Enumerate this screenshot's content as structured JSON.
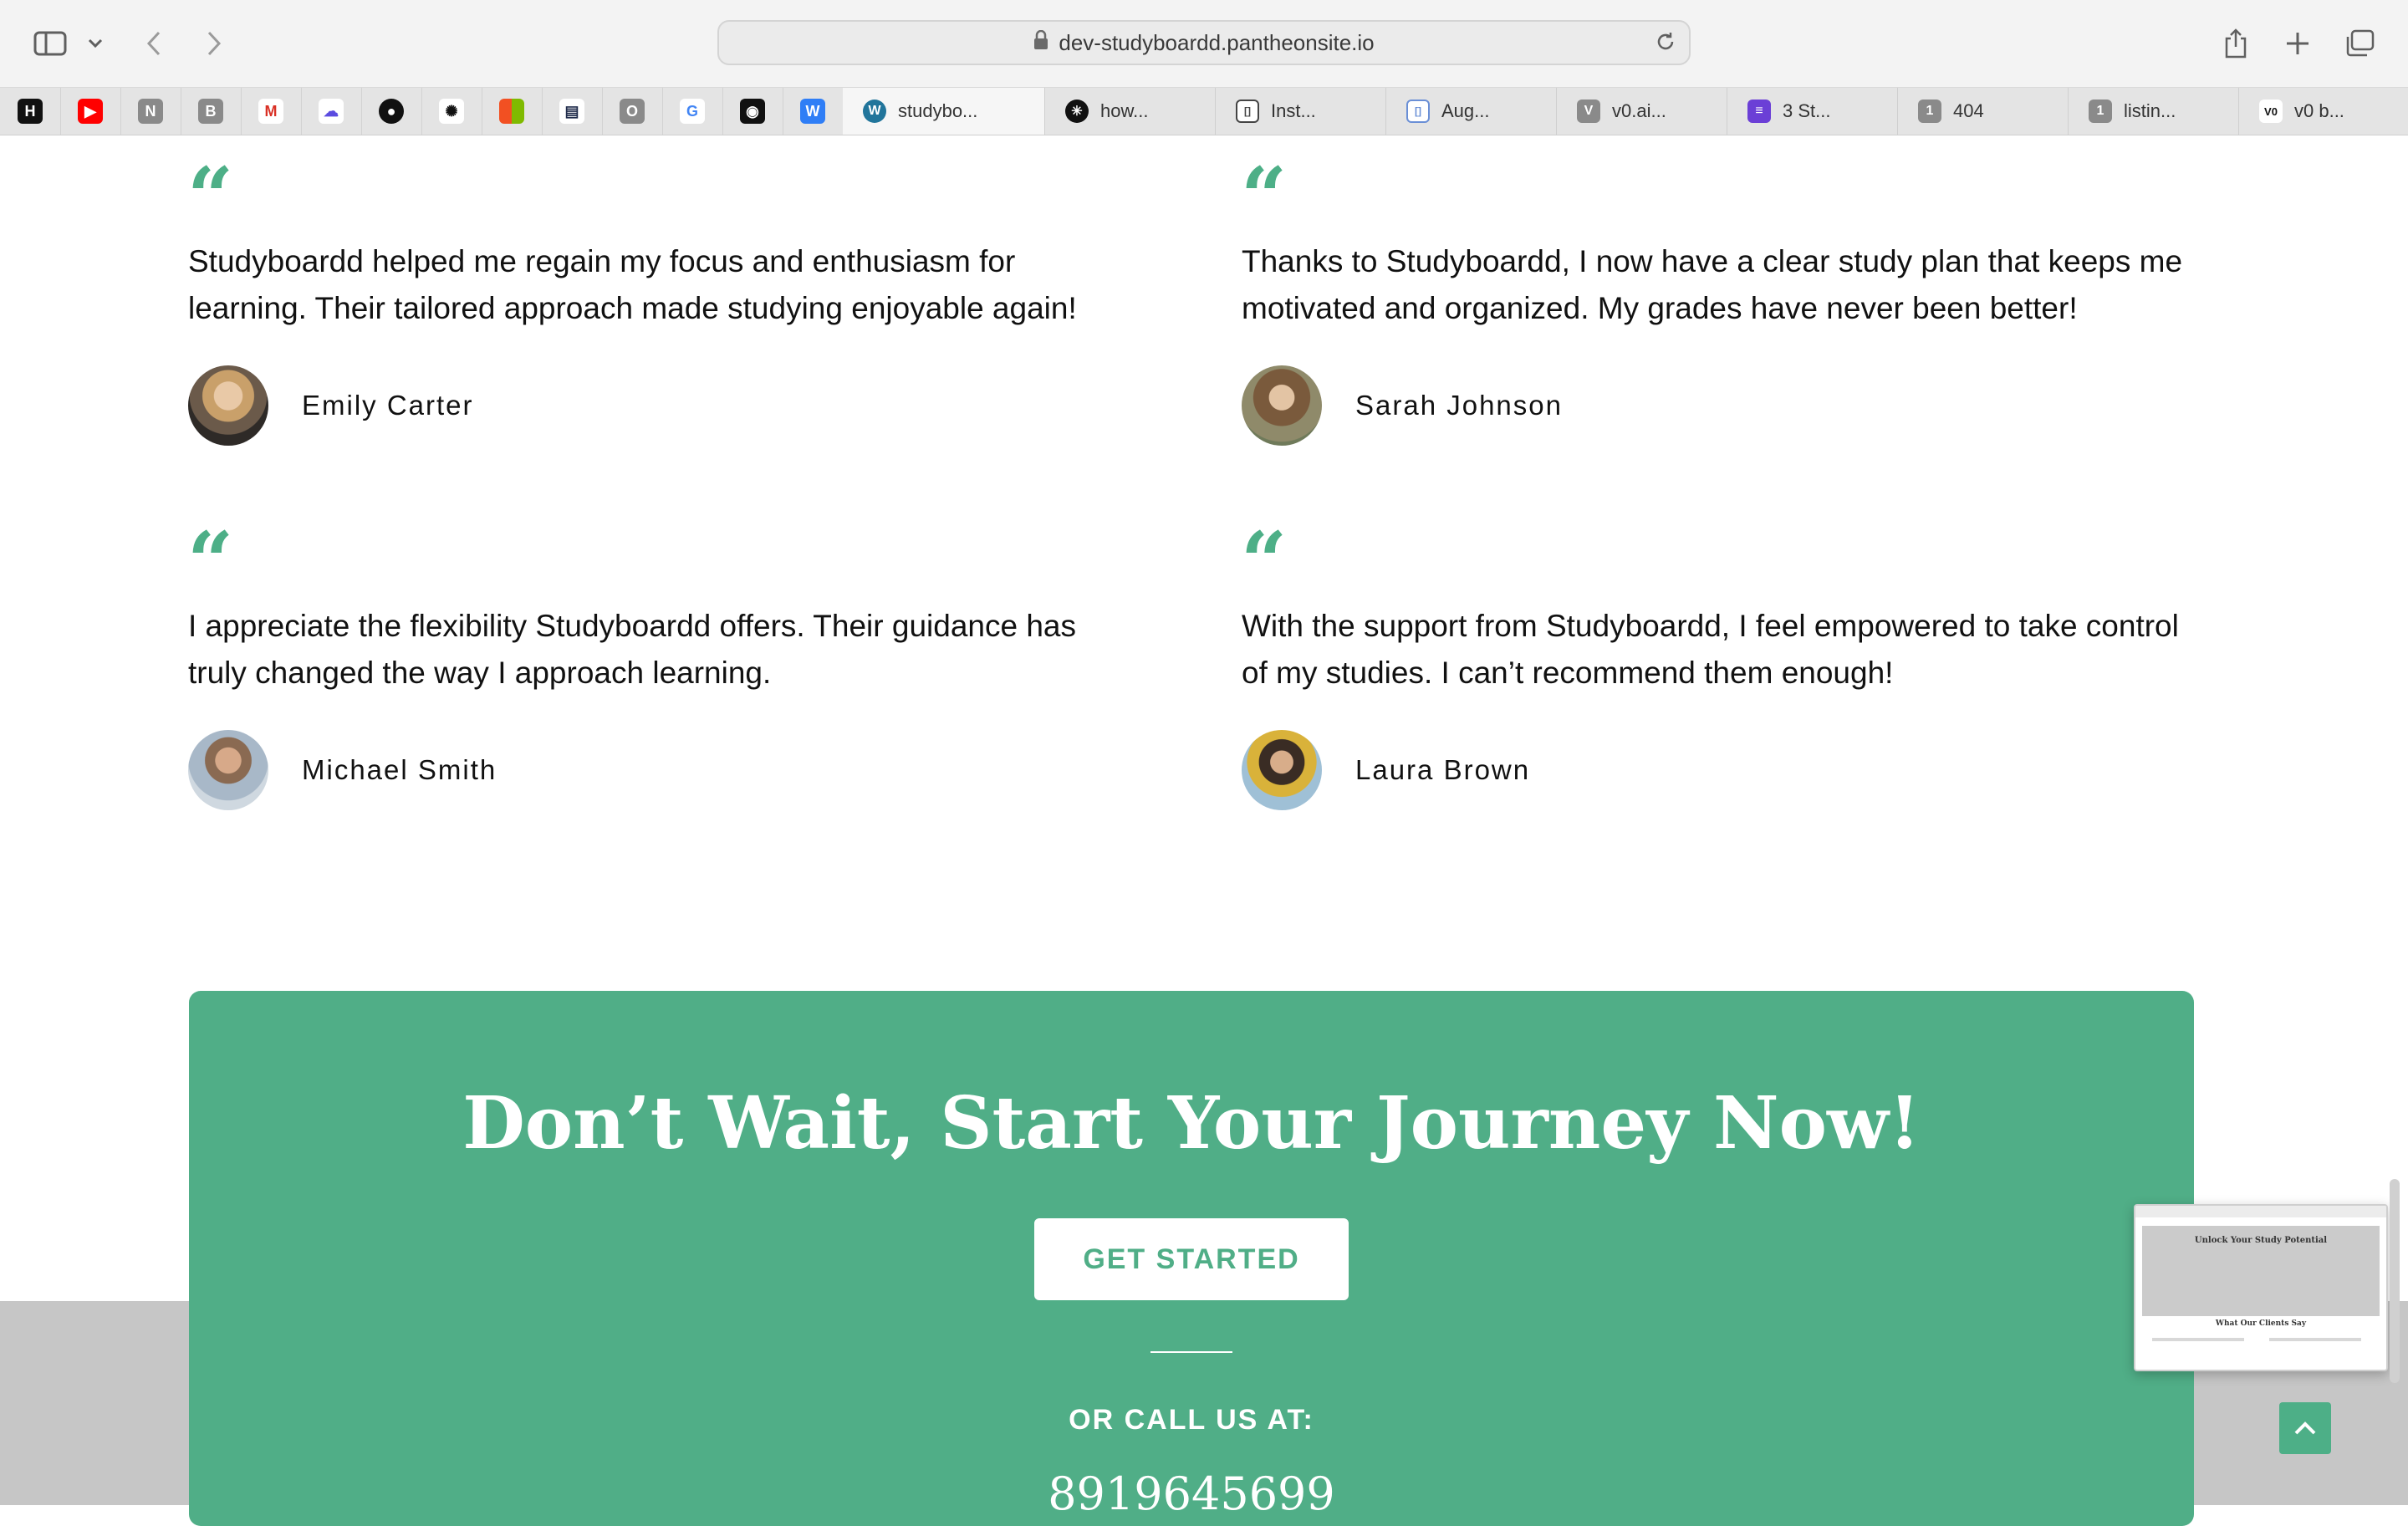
{
  "browser": {
    "url": "dev-studyboardd.pantheonsite.io",
    "pinned_tabs": [
      {
        "icon": "hn-icon",
        "glyph": "H",
        "color": "#111111"
      },
      {
        "icon": "youtube-icon",
        "glyph": "▶",
        "color": "#ff0000"
      },
      {
        "icon": "n-icon",
        "glyph": "N",
        "color": "#8a8a8a"
      },
      {
        "icon": "b-icon",
        "glyph": "B",
        "color": "#8a8a8a"
      },
      {
        "icon": "gmail-icon",
        "glyph": "M",
        "color": "#d93025"
      },
      {
        "icon": "cloud-icon",
        "glyph": "☁",
        "color": "#5b4ce0"
      },
      {
        "icon": "github-icon",
        "glyph": "●",
        "color": "#111111"
      },
      {
        "icon": "openai-icon",
        "glyph": "✺",
        "color": "#111111"
      },
      {
        "icon": "microsoft-icon",
        "glyph": "▦",
        "color": "#f25022"
      },
      {
        "icon": "linear-icon",
        "glyph": "▤",
        "color": "#1e2a4a"
      },
      {
        "icon": "o-icon",
        "glyph": "O",
        "color": "#8a8a8a"
      },
      {
        "icon": "google-icon",
        "glyph": "G",
        "color": "#4285f4"
      },
      {
        "icon": "chatgpt-icon",
        "glyph": "◉",
        "color": "#111111"
      },
      {
        "icon": "w-icon",
        "glyph": "W",
        "color": "#2f7ef6"
      }
    ],
    "tabs": [
      {
        "label": "studybo...",
        "icon": "wordpress-icon",
        "glyph": "W",
        "color": "#21759b",
        "active": true
      },
      {
        "label": "how...",
        "icon": "perplexity-icon",
        "glyph": "✳",
        "color": "#111111",
        "active": false
      },
      {
        "label": "Inst...",
        "icon": "bracket-icon",
        "glyph": "[]",
        "color": "#444444",
        "active": false
      },
      {
        "label": "Aug...",
        "icon": "bracket-icon",
        "glyph": "[]",
        "color": "#6a8fd6",
        "active": false
      },
      {
        "label": "v0.ai...",
        "icon": "v-icon",
        "glyph": "V",
        "color": "#8a8a8a",
        "active": false
      },
      {
        "label": "3 St...",
        "icon": "linear-icon",
        "glyph": "≡",
        "color": "#6b3fd6",
        "active": false
      },
      {
        "label": "404",
        "icon": "one-icon",
        "glyph": "1",
        "color": "#8a8a8a",
        "active": false
      },
      {
        "label": "listin...",
        "icon": "one-icon",
        "glyph": "1",
        "color": "#8a8a8a",
        "active": false
      },
      {
        "label": "v0 b...",
        "icon": "v0-icon",
        "glyph": "V0",
        "color": "#111111",
        "active": false
      }
    ]
  },
  "testimonials": [
    {
      "text": "Studyboardd helped me regain my focus and enthusiasm for learning. Their tailored approach made studying enjoyable again!",
      "name": "Emily Carter"
    },
    {
      "text": "Thanks to Studyboardd, I now have a clear study plan that keeps me motivated and organized. My grades have never been better!",
      "name": "Sarah Johnson"
    },
    {
      "text": "I appreciate the flexibility Studyboardd offers. Their guidance has truly changed the way I approach learning.",
      "name": "Michael Smith"
    },
    {
      "text": "With the support from Studyboardd, I feel empowered to take control of my studies. I can’t recommend them enough!",
      "name": "Laura Brown"
    }
  ],
  "cta": {
    "title": "Don’t Wait, Start Your Journey Now!",
    "button": "GET STARTED",
    "call_label": "OR CALL US AT:",
    "phone": "8919645699"
  },
  "thumbnail": {
    "title": "Unlock Your Study Potential",
    "subtitle": "What Our Clients Say"
  },
  "colors": {
    "accent": "#50ae87"
  }
}
